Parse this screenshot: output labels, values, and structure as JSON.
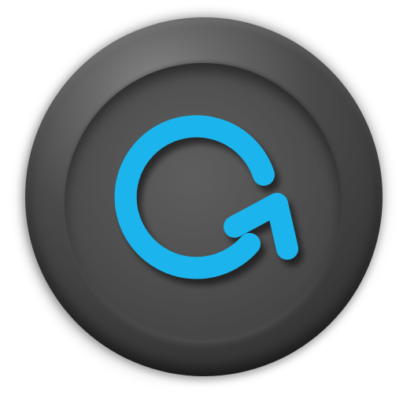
{
  "control": {
    "icon": "refresh-icon",
    "icon_color": "#1cb4ec",
    "body_color": "#4d4d4d",
    "background_color": "#ffffff"
  }
}
